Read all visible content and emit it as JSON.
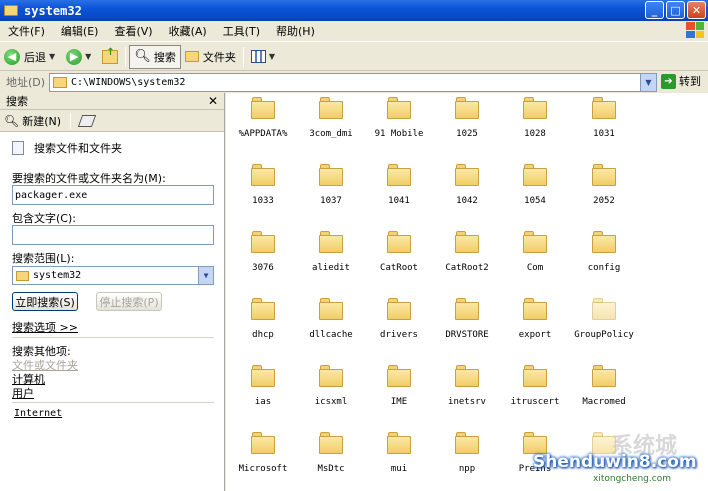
{
  "window": {
    "title": "system32"
  },
  "menu": [
    "文件(F)",
    "编辑(E)",
    "查看(V)",
    "收藏(A)",
    "工具(T)",
    "帮助(H)"
  ],
  "toolbar": {
    "back": "后退",
    "search": "搜索",
    "folders": "文件夹"
  },
  "address": {
    "label": "地址(D)",
    "path": "C:\\WINDOWS\\system32",
    "go": "转到"
  },
  "search_pane": {
    "title": "搜索",
    "new_label": "新建(N)",
    "heading": "搜索文件和文件夹",
    "name_label": "要搜索的文件或文件夹名为(M):",
    "name_value": "packager.exe",
    "contains_label": "包含文字(C):",
    "contains_value": "",
    "scope_label": "搜索范围(L):",
    "scope_value": "system32",
    "search_now": "立即搜索(S)",
    "stop_search": "停止搜索(P)",
    "options": "搜索选项 >>",
    "other_label": "搜索其他项:",
    "other_items": [
      "文件或文件夹",
      "计算机",
      "用户"
    ],
    "internet": "Internet"
  },
  "folders": [
    "%APPDATA%",
    "3com_dmi",
    "91 Mobile",
    "1025",
    "1028",
    "1031",
    "1033",
    "1037",
    "1041",
    "1042",
    "1054",
    "2052",
    "3076",
    "aliedit",
    "CatRoot",
    "CatRoot2",
    "Com",
    "config",
    "dhcp",
    "dllcache",
    "drivers",
    "DRVSTORE",
    "export",
    "GroupPolicy",
    "ias",
    "icsxml",
    "IME",
    "inetsrv",
    "itruscert",
    "Macromed",
    "Microsoft",
    "MsDtc",
    "mui",
    "npp",
    "PreIns",
    ""
  ],
  "watermark": {
    "site": "Shenduwin8.com",
    "sub": "xitongcheng.com",
    "cn": "系统城"
  },
  "colors": {
    "titlebar": "#0a54d8",
    "folder": "#f1cd66",
    "watermark": "#2266cc"
  },
  "icons": {
    "back": "back-arrow-icon",
    "forward": "forward-arrow-icon",
    "up": "up-folder-icon",
    "search": "magnifier-icon",
    "folders": "folder-icon",
    "views": "views-icon"
  }
}
